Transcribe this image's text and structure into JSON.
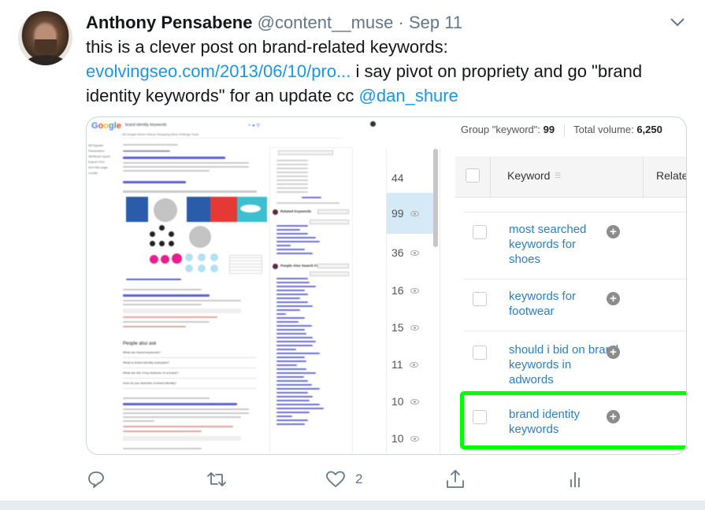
{
  "tweet": {
    "author_name": "Anthony Pensabene",
    "handle": "@content__muse",
    "separator": "·",
    "date": "Sep 11",
    "text_line1": "this is a clever post on brand-related keywords:",
    "link": "evolvingseo.com/2013/06/10/pro...",
    "text_after_link": " i say pivot on propriety and go \"brand identity keywords\" for an update cc ",
    "mention": "@dan_shure"
  },
  "icons": {
    "more": "chevron-down-icon",
    "reply": "reply-icon",
    "retweet": "retweet-icon",
    "like": "heart-icon",
    "share": "share-icon",
    "analytics": "analytics-icon"
  },
  "actions": {
    "like_count": "2"
  },
  "media": {
    "serp": {
      "logo_letters": [
        "G",
        "o",
        "o",
        "g",
        "l",
        "e"
      ],
      "query": "brand identity keywords",
      "tabs": "All   Images   News   Videos   Shopping   More      Settings   Tools",
      "sidebar": [
        "SEOquake",
        "Parameters",
        "SEMrush report",
        "Export CSV",
        "Sort this page",
        "Locale"
      ],
      "images_heading": "Images for brand identity keywords",
      "paa_heading": "People also ask",
      "paa_questions": [
        "What are brand keywords?",
        "What is brand identity examples?",
        "What are the 3 key features of a brand?",
        "How do you describe a brand identity?"
      ],
      "result1_title": "Keyword Research Simplified - Just Enter Any Keyword",
      "result2_title": "1. How To Define Your Brand Personality | FINEN",
      "result3_title": "3. Keywords: The First Step to Building A Strong Brand Identity",
      "panel_related": "Related Keywords",
      "panel_people": "People Also Search For"
    },
    "volumes": [
      {
        "value": "44",
        "selected": false,
        "eye": false
      },
      {
        "value": "99",
        "selected": true,
        "eye": true
      },
      {
        "value": "36",
        "selected": false,
        "eye": true
      },
      {
        "value": "16",
        "selected": false,
        "eye": true
      },
      {
        "value": "15",
        "selected": false,
        "eye": true
      },
      {
        "value": "11",
        "selected": false,
        "eye": true
      },
      {
        "value": "10",
        "selected": false,
        "eye": true
      },
      {
        "value": "10",
        "selected": false,
        "eye": true
      }
    ],
    "keyword_table": {
      "group_label": "Group \"keyword\":",
      "group_count": "99",
      "total_volume_label": "Total volume:",
      "total_volume": "6,250",
      "col_keyword": "Keyword",
      "col_related": "Relate",
      "rows": [
        {
          "keyword": "most searched keywords for shoes",
          "highlighted": false
        },
        {
          "keyword": "keywords for footwear",
          "highlighted": false
        },
        {
          "keyword": "should i bid on brand keywords in adwords",
          "highlighted": false
        },
        {
          "keyword": "brand identity keywords",
          "highlighted": true
        }
      ],
      "highlight_color": "#00ff00"
    }
  },
  "colors": {
    "link": "#1b95e0",
    "muted": "#657786",
    "keyword_link": "#2a7ec2",
    "selected_row": "#d5e9f7"
  }
}
